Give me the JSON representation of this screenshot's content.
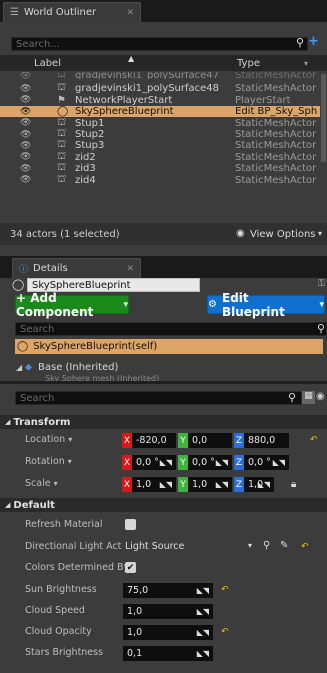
{
  "outliner": {
    "tab_title": "World Outliner",
    "search_placeholder": "Search...",
    "col_label": "Label",
    "col_type": "Type",
    "rows": [
      {
        "name": "gradjevinski1_polySurface47",
        "type": "StaticMeshActor",
        "icon": "mesh-icon",
        "faded": true
      },
      {
        "name": "gradjevinski1_polySurface48",
        "type": "StaticMeshActor",
        "icon": "mesh-icon"
      },
      {
        "name": "NetworkPlayerStart",
        "type": "PlayerStart",
        "icon": "player-start-icon"
      },
      {
        "name": "SkySphereBlueprint",
        "type": "Edit BP_Sky_Sph",
        "icon": "sphere-icon",
        "selected": true
      },
      {
        "name": "Stup1",
        "type": "StaticMeshActor",
        "icon": "mesh-icon"
      },
      {
        "name": "Stup2",
        "type": "StaticMeshActor",
        "icon": "mesh-icon"
      },
      {
        "name": "Stup3",
        "type": "StaticMeshActor",
        "icon": "mesh-icon"
      },
      {
        "name": "zid2",
        "type": "StaticMeshActor",
        "icon": "mesh-icon"
      },
      {
        "name": "zid3",
        "type": "StaticMeshActor",
        "icon": "mesh-icon"
      },
      {
        "name": "zid4",
        "type": "StaticMeshActor",
        "icon": "mesh-icon"
      }
    ],
    "actor_count": "34 actors (1 selected)",
    "view_options": "View Options"
  },
  "details": {
    "tab_title": "Details",
    "name_value": "SkySphereBlueprint",
    "add_component": "+ Add Component",
    "edit_blueprint": "Edit Blueprint",
    "comp_search_placeholder": "Search",
    "self_component": "SkySphereBlueprint(self)",
    "base_inherited": "Base (Inherited)",
    "sky_mesh_faded": "Sky Sphere mesh (Inherited)",
    "prop_search_placeholder": "Search",
    "transform_title": "Transform",
    "location_label": "Location",
    "location": {
      "x": "-820,0",
      "y": "0,0",
      "z": "880,0"
    },
    "rotation_label": "Rotation",
    "rotation": {
      "x": "0,0 °",
      "y": "0,0 °",
      "z": "0,0 °"
    },
    "scale_label": "Scale",
    "scale": {
      "x": "1,0",
      "y": "1,0",
      "z": "1,0"
    },
    "default_title": "Default",
    "refresh_material": "Refresh Material",
    "directional_light_actor": "Directional Light Actor",
    "light_source": "Light Source",
    "colors_determined_by": "Colors Determined By",
    "sun_brightness_label": "Sun Brightness",
    "sun_brightness": "75,0",
    "cloud_speed_label": "Cloud Speed",
    "cloud_speed": "1,0",
    "cloud_opacity_label": "Cloud Opacity",
    "cloud_opacity": "1,0",
    "stars_brightness_label": "Stars Brightness",
    "stars_brightness": "0,1"
  }
}
